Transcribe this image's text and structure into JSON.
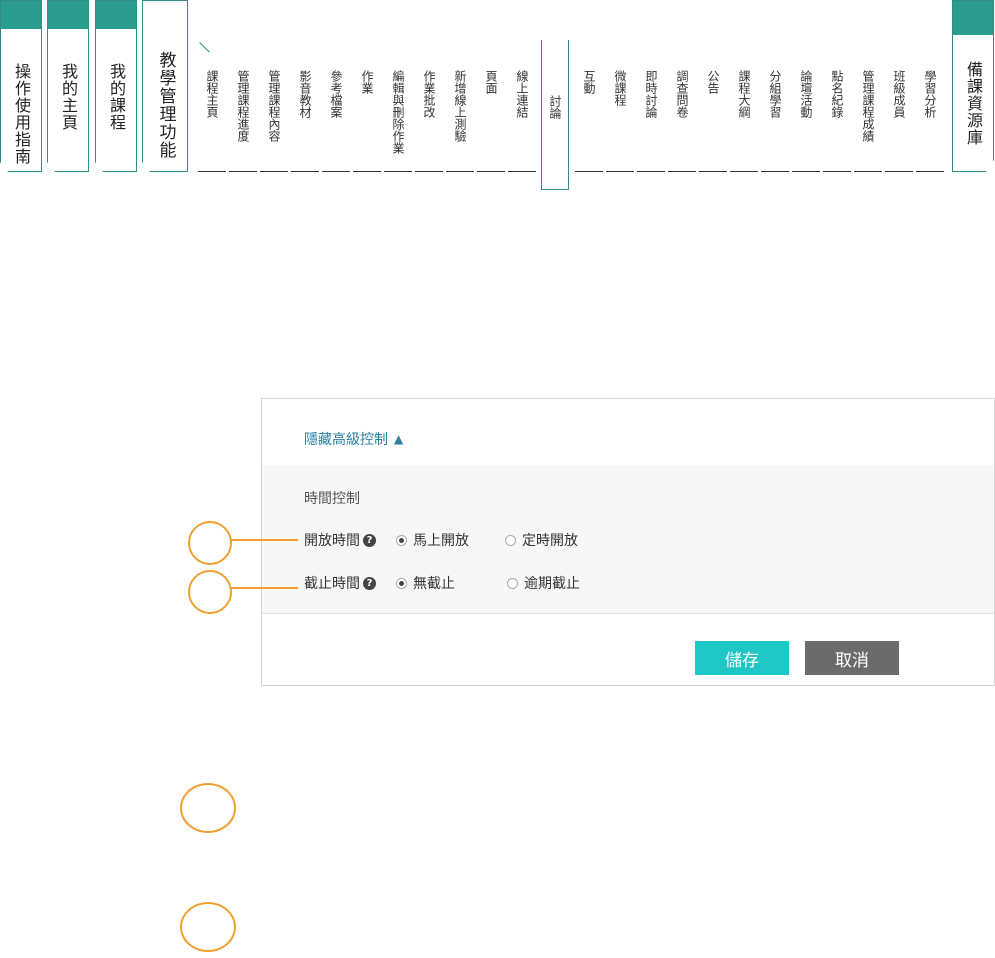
{
  "nav": {
    "main_tabs": [
      {
        "label": "操作使用指南"
      },
      {
        "label": "我的主頁"
      },
      {
        "label": "我的課程"
      },
      {
        "label": "教學管理功能"
      }
    ],
    "sub_tabs": [
      {
        "label": "課程主頁"
      },
      {
        "label": "管理課程進度"
      },
      {
        "label": "管理課程內容"
      },
      {
        "label": "影音教材"
      },
      {
        "label": "參考檔案"
      },
      {
        "label": "作業"
      },
      {
        "label": "編輯與刪除作業"
      },
      {
        "label": "作業批改"
      },
      {
        "label": "新增線上測驗"
      },
      {
        "label": "頁面"
      },
      {
        "label": "線上連結"
      },
      {
        "label": "討論"
      },
      {
        "label": "互動"
      },
      {
        "label": "微課程"
      },
      {
        "label": "即時討論"
      },
      {
        "label": "調查問卷"
      },
      {
        "label": "公告"
      },
      {
        "label": "課程大綱"
      },
      {
        "label": "分組學習"
      },
      {
        "label": "論壇活動"
      },
      {
        "label": "點名紀錄"
      },
      {
        "label": "管理課程成績"
      },
      {
        "label": "班級成員"
      },
      {
        "label": "學習分析"
      }
    ],
    "active_sub_tab": "討論",
    "resource_tab": "備課資源庫"
  },
  "panel": {
    "toggle_label": "隱藏高級控制",
    "section_title": "時間控制",
    "open_time": {
      "label": "開放時間",
      "options": [
        "馬上開放",
        "定時開放"
      ],
      "selected": "馬上開放"
    },
    "deadline": {
      "label": "截止時間",
      "options": [
        "無截止",
        "逾期截止"
      ],
      "selected": "無截止"
    },
    "save_label": "儲存",
    "cancel_label": "取消"
  },
  "colors": {
    "teal": "#2a9d8f",
    "link": "#2a7f9e",
    "save": "#1ec6c6",
    "cancel": "#6b6b6b",
    "callout": "#f0a030"
  }
}
